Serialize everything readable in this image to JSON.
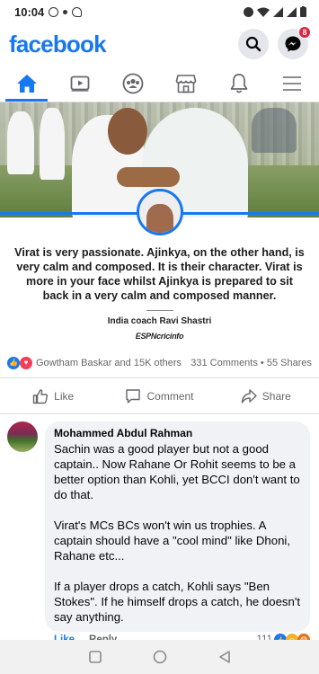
{
  "status_bar": {
    "time": "10:04"
  },
  "header": {
    "logo": "facebook",
    "messenger_badge": "8"
  },
  "nav": {
    "tabs": [
      "home-icon",
      "watch-icon",
      "groups-icon",
      "marketplace-icon",
      "notifications-icon",
      "menu-icon"
    ],
    "active": 0
  },
  "post": {
    "quote": "Virat is very passionate. Ajinkya, on the other hand, is very calm and composed. It is their character. Virat is more in your face whilst Ajinkya is prepared to sit back in a very calm and composed manner.",
    "attribution": "India coach Ravi Shastri",
    "brand": "ESPNcricinfo",
    "reactions_text": "Gowtham Baskar and 15K others",
    "comments_count": "331 Comments",
    "shares_count": "55 Shares",
    "actions": {
      "like": "Like",
      "comment": "Comment",
      "share": "Share"
    }
  },
  "comment": {
    "author": "Mohammed Abdul Rahman",
    "paragraphs": [
      "Sachin was a good player but not a good captain.. Now Rahane Or Rohit seems to be a better option than Kohli, yet BCCI don't want to do that.",
      "Virat's MCs BCs won't win us trophies. A captain should have a \"cool mind\" like Dhoni, Rahane etc...",
      "If a player drops a catch, Kohli says \"Ben Stokes\". If he himself drops a catch, he doesn't say anything."
    ],
    "like_label": "Like",
    "reply_label": "Reply",
    "reaction_count": "111"
  },
  "colors": {
    "brand": "#1877f2",
    "muted": "#65676b",
    "bubble": "#f0f2f5"
  }
}
